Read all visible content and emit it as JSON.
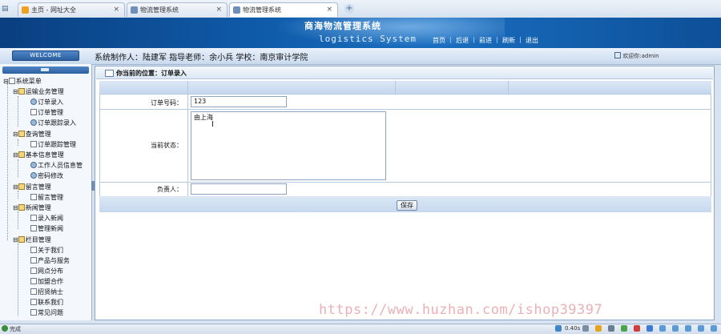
{
  "browser": {
    "tabs": [
      {
        "label": "主页 - 网址大全",
        "active": false
      },
      {
        "label": "物流管理系统",
        "active": false
      },
      {
        "label": "物流管理系统",
        "active": true
      }
    ],
    "close_glyph": "×",
    "new_tab_glyph": "+"
  },
  "header": {
    "title": "商海物流管理系统",
    "subtitle": "logistics System",
    "nav": [
      "首页",
      "后退",
      "前进",
      "刷新",
      "退出"
    ]
  },
  "infobar": {
    "welcome": "WELCOME",
    "credits": "系统制作人：陆建军  指导老师：余小兵  学校：南京审计学院",
    "user": "欢迎你:admin"
  },
  "sidebar": {
    "root": "系统菜单",
    "groups": [
      {
        "label": "运输业务管理",
        "items": [
          "订单录入",
          "订单管理",
          "订单跟踪录入"
        ]
      },
      {
        "label": "查询管理",
        "items": [
          "订单跟踪管理"
        ]
      },
      {
        "label": "基本信息管理",
        "items": [
          "工作人员信息管",
          "密码修改"
        ]
      },
      {
        "label": "留言管理",
        "items": [
          "留言管理"
        ]
      },
      {
        "label": "新闻管理",
        "items": [
          "录入新闻",
          "管理新闻"
        ]
      },
      {
        "label": "栏目管理",
        "items": [
          "关于我们",
          "产品与服务",
          "网点分布",
          "加盟合作",
          "招贤纳士",
          "联系我们",
          "常见问题"
        ]
      }
    ]
  },
  "breadcrumb": "你当前的位置：订单录入",
  "form": {
    "order_no_label": "订单号码：",
    "order_no_value": "123",
    "status_label": "当前状态：",
    "status_value": "由上海",
    "owner_label": "负责人：",
    "owner_value": "",
    "save_label": "保存"
  },
  "watermark": "https://www.huzhan.com/ishop39397",
  "statusbar": {
    "text": "完成",
    "timing": "0.40s"
  },
  "colors": {
    "banner": "#0f5aa8",
    "panel_border": "#8aa6c8",
    "strip": "#c6d8ee"
  }
}
